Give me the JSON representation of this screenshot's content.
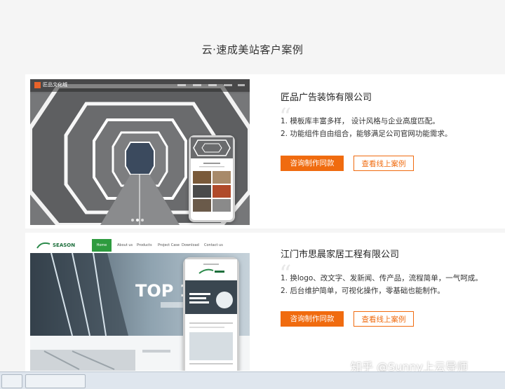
{
  "section": {
    "title": "云·速成美站客户案例"
  },
  "cases": [
    {
      "company": "匠品广告装饰有限公司",
      "points": [
        "1. 模板库丰富多样， 设计风格与企业高度匹配。",
        "2. 功能组件自由组合，能够满足公司官网功能需求。"
      ],
      "primary_label": "咨询制作同款",
      "secondary_label": "查看线上案例",
      "preview": {
        "logo_text": "匠品文化城"
      }
    },
    {
      "company": "江门市思晨家居工程有限公司",
      "points": [
        "1. 换logo、改文字、发新闻、传产品，流程简单，一气呵成。",
        "2. 后台维护简单，可视化操作，零基础也能制作。"
      ],
      "primary_label": "咨询制作同款",
      "secondary_label": "查看线上案例",
      "preview": {
        "logo_text": "SEASON",
        "hero_text": "TOP 1",
        "nav_tabs": [
          "Home",
          "About us",
          "Products",
          "Project Case",
          "Download",
          "Contact us"
        ]
      }
    }
  ],
  "watermark": "知乎 @Sunny上云导师",
  "colors": {
    "accent": "#f06b0f",
    "background": "#f5f5f5"
  }
}
